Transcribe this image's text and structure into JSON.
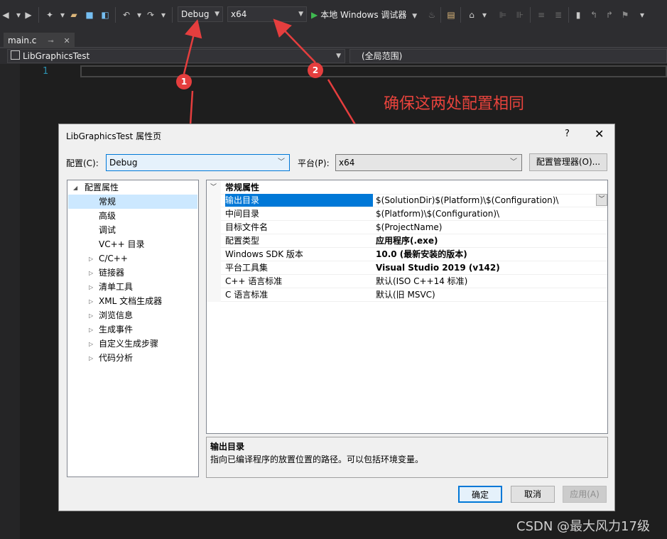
{
  "toolbar": {
    "config_value": "Debug",
    "platform_value": "x64",
    "run_label": "本地 Windows 调试器"
  },
  "tabs": [
    {
      "label": "main.c"
    }
  ],
  "navbar": {
    "project": "LibGraphicsTest",
    "scope": "(全局范围)"
  },
  "editor": {
    "line_number": "1"
  },
  "annotation": {
    "text": "确保这两处配置相同",
    "badge1": "1",
    "badge2": "2",
    "color": "#e53e3e"
  },
  "dialog": {
    "title": "LibGraphicsTest 属性页",
    "help": "?",
    "close": "✕",
    "config_label": "配置(C):",
    "config_value": "Debug",
    "platform_label": "平台(P):",
    "platform_value": "x64",
    "config_manager_label": "配置管理器(O)...",
    "tree": {
      "root": "配置属性",
      "items": [
        "常规",
        "高级",
        "调试",
        "VC++ 目录",
        "C/C++",
        "链接器",
        "清单工具",
        "XML 文档生成器",
        "浏览信息",
        "生成事件",
        "自定义生成步骤",
        "代码分析"
      ]
    },
    "grid": {
      "category": "常规属性",
      "rows": [
        {
          "name": "输出目录",
          "value": "$(SolutionDir)$(Platform)\\$(Configuration)\\"
        },
        {
          "name": "中间目录",
          "value": "$(Platform)\\$(Configuration)\\"
        },
        {
          "name": "目标文件名",
          "value": "$(ProjectName)"
        },
        {
          "name": "配置类型",
          "value": "应用程序(.exe)"
        },
        {
          "name": "Windows SDK 版本",
          "value": "10.0 (最新安装的版本)"
        },
        {
          "name": "平台工具集",
          "value": "Visual Studio 2019 (v142)"
        },
        {
          "name": "C++ 语言标准",
          "value": "默认(ISO C++14 标准)"
        },
        {
          "name": "C 语言标准",
          "value": "默认(旧 MSVC)"
        }
      ]
    },
    "description": {
      "title": "输出目录",
      "text": "指向已编译程序的放置位置的路径。可以包括环境变量。"
    },
    "buttons": {
      "ok": "确定",
      "cancel": "取消",
      "apply": "应用(A)"
    }
  },
  "watermark": "CSDN @最大风力17级"
}
